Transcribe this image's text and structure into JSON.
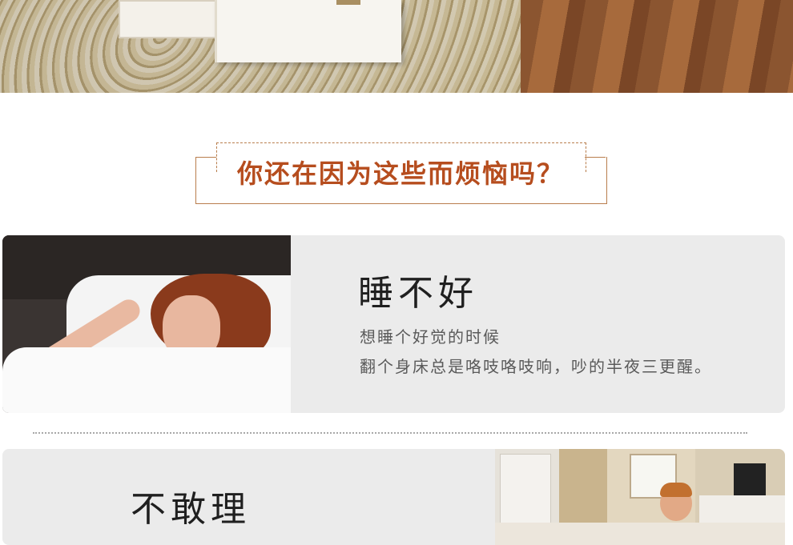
{
  "question_title": "你还在因为这些而烦恼吗？",
  "section1": {
    "title": "睡不好",
    "line1": "想睡个好觉的时候",
    "line2": "翻个身床总是咯吱咯吱响，吵的半夜三更醒。"
  },
  "section2": {
    "title": "不敢理"
  },
  "colors": {
    "accent": "#b64d1e",
    "card_bg": "#ebebeb"
  }
}
